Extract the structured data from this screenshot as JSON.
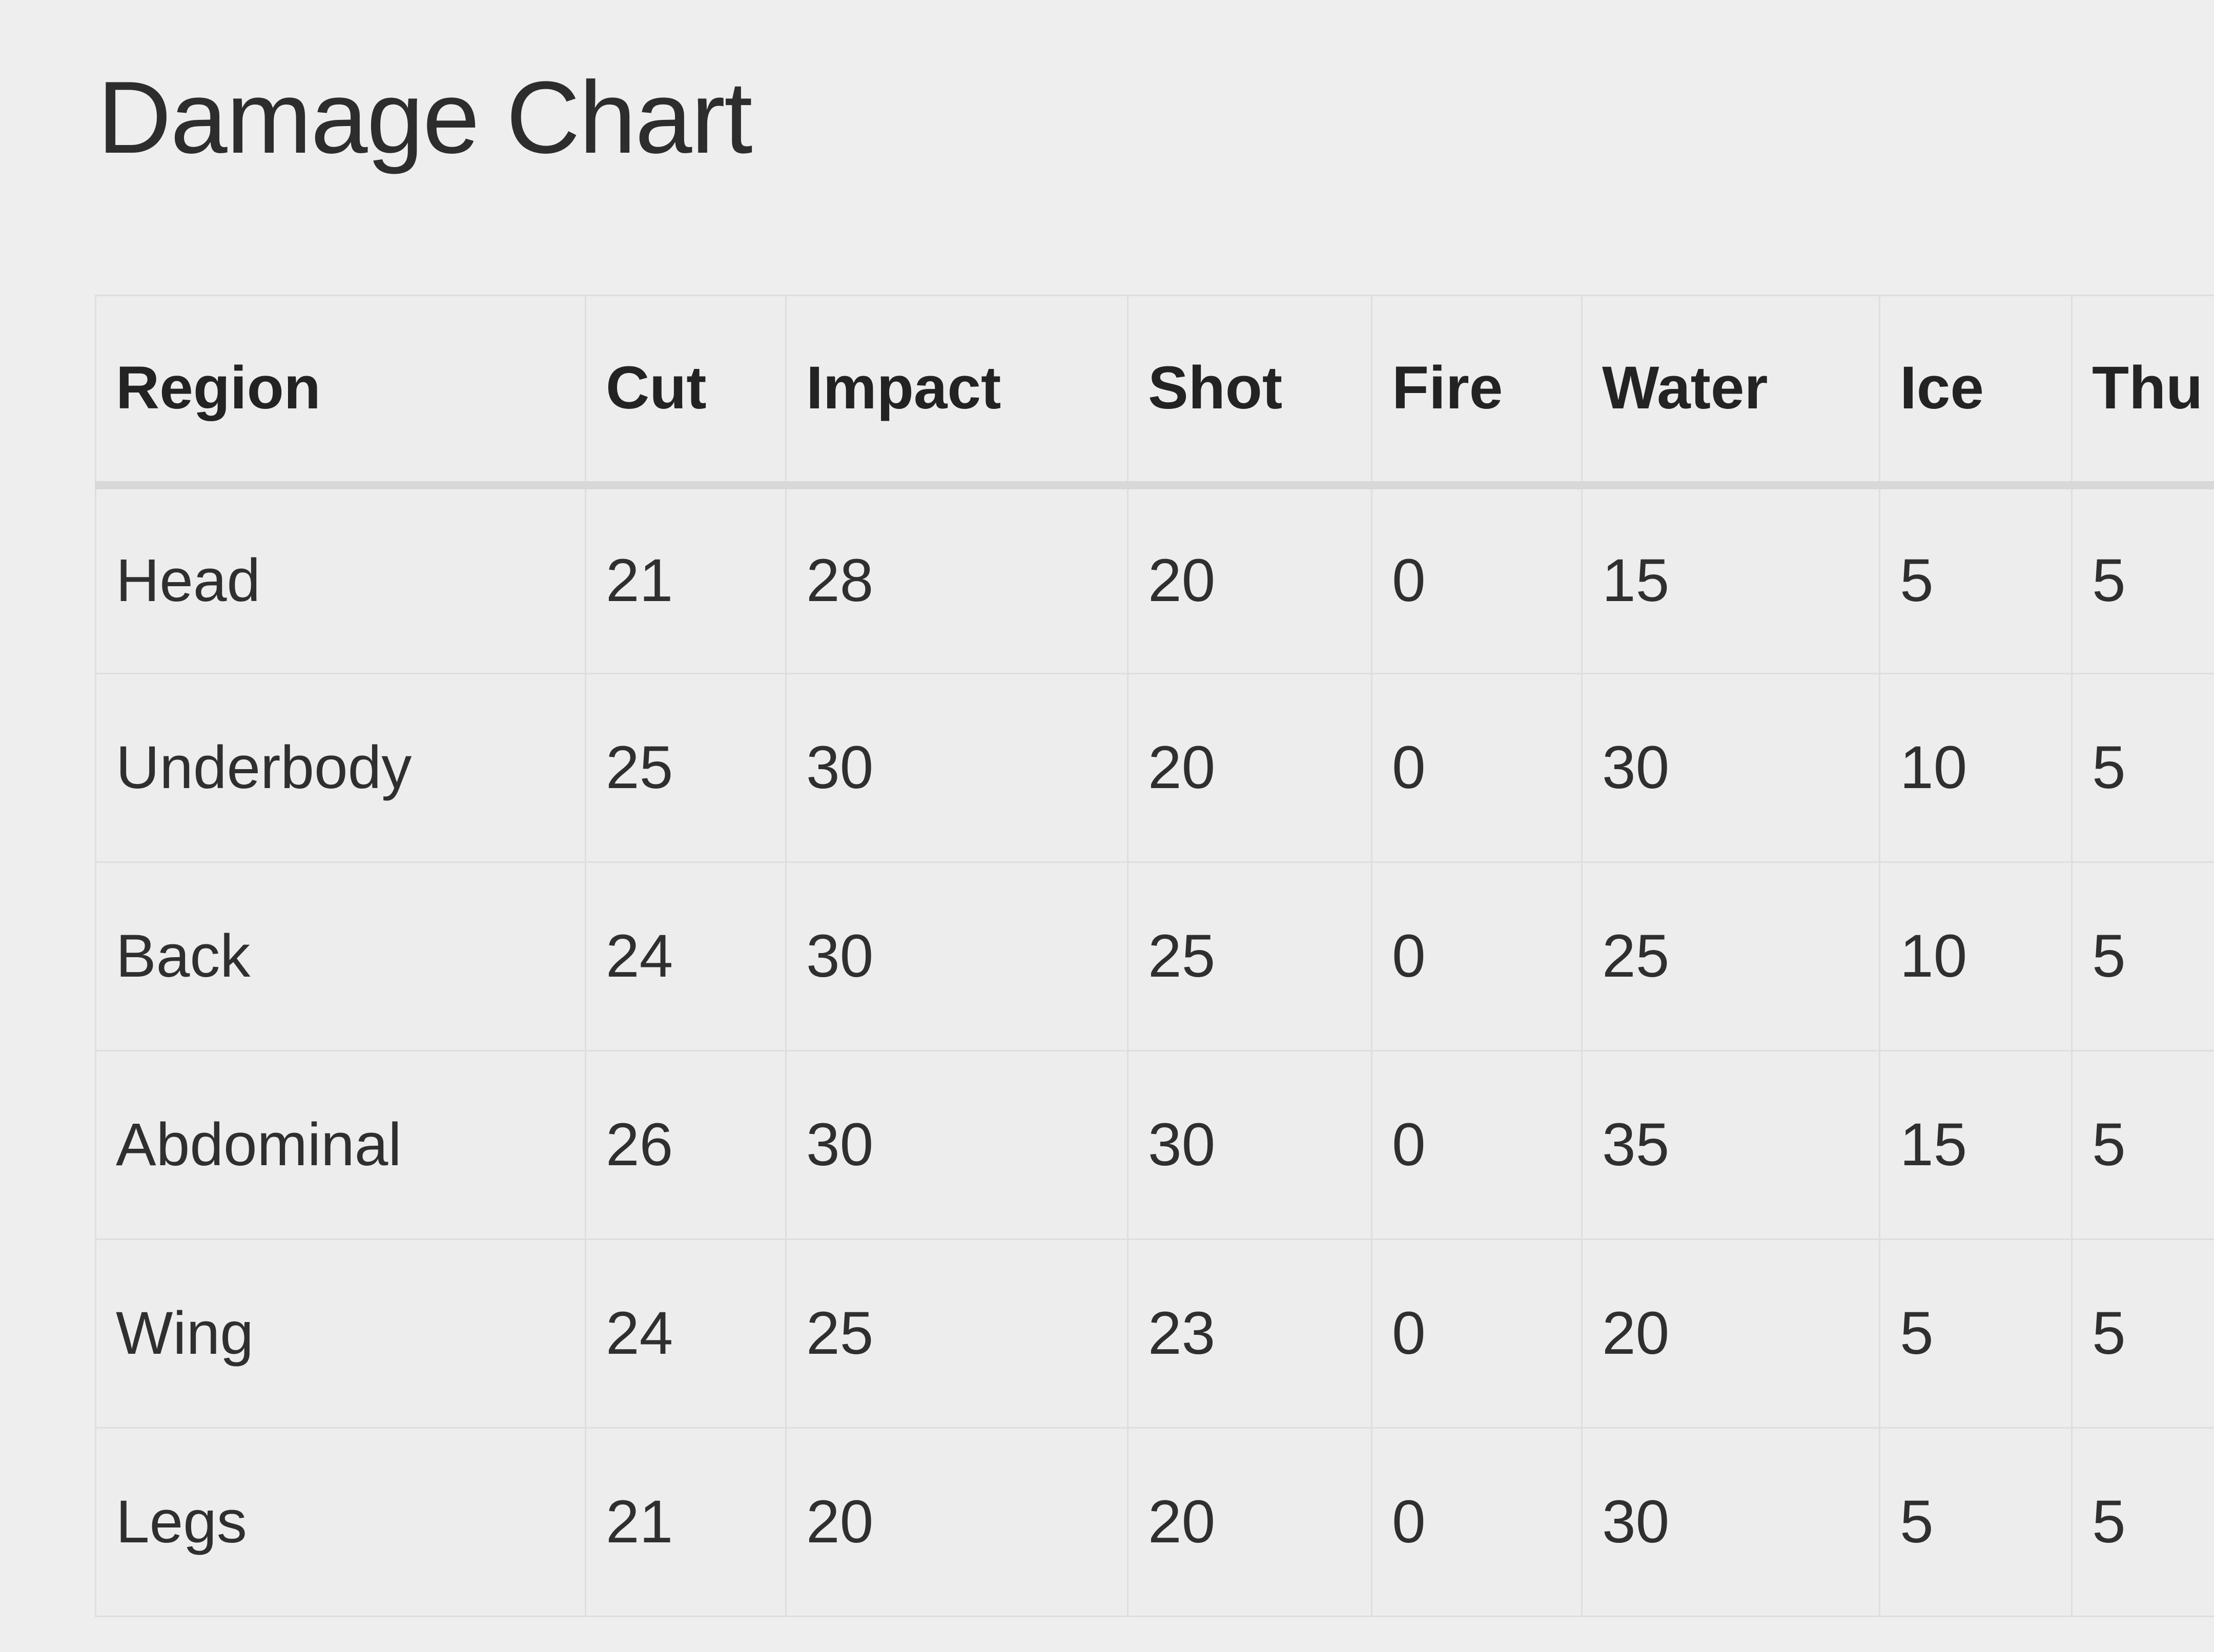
{
  "page": {
    "title": "Damage Chart",
    "background_color": "#eeeeee",
    "text_color": "#2d2d2d",
    "border_color": "#dedede",
    "header_divider_color": "#d8d8d8"
  },
  "table": {
    "name": "damage-chart-table",
    "columns": [
      {
        "key": "region",
        "label": "Region"
      },
      {
        "key": "cut",
        "label": "Cut"
      },
      {
        "key": "impact",
        "label": "Impact"
      },
      {
        "key": "shot",
        "label": "Shot"
      },
      {
        "key": "fire",
        "label": "Fire"
      },
      {
        "key": "water",
        "label": "Water"
      },
      {
        "key": "ice",
        "label": "Ice"
      },
      {
        "key": "thunder",
        "label": "Thu"
      }
    ],
    "rows": [
      {
        "region": "Head",
        "cut": "21",
        "impact": "28",
        "shot": "20",
        "fire": "0",
        "water": "15",
        "ice": "5",
        "thunder": "5"
      },
      {
        "region": "Underbody",
        "cut": "25",
        "impact": "30",
        "shot": "20",
        "fire": "0",
        "water": "30",
        "ice": "10",
        "thunder": "5"
      },
      {
        "region": "Back",
        "cut": "24",
        "impact": "30",
        "shot": "25",
        "fire": "0",
        "water": "25",
        "ice": "10",
        "thunder": "5"
      },
      {
        "region": "Abdominal",
        "cut": "26",
        "impact": "30",
        "shot": "30",
        "fire": "0",
        "water": "35",
        "ice": "15",
        "thunder": "5"
      },
      {
        "region": "Wing",
        "cut": "24",
        "impact": "25",
        "shot": "23",
        "fire": "0",
        "water": "20",
        "ice": "5",
        "thunder": "5"
      },
      {
        "region": "Legs",
        "cut": "21",
        "impact": "20",
        "shot": "20",
        "fire": "0",
        "water": "30",
        "ice": "5",
        "thunder": "5"
      }
    ]
  },
  "chart_data": {
    "type": "table",
    "title": "Damage Chart",
    "categories": [
      "Head",
      "Underbody",
      "Back",
      "Abdominal",
      "Wing",
      "Legs"
    ],
    "series": [
      {
        "name": "Cut",
        "values": [
          21,
          25,
          24,
          26,
          24,
          21
        ]
      },
      {
        "name": "Impact",
        "values": [
          28,
          30,
          30,
          30,
          25,
          20
        ]
      },
      {
        "name": "Shot",
        "values": [
          20,
          20,
          25,
          30,
          23,
          20
        ]
      },
      {
        "name": "Fire",
        "values": [
          0,
          0,
          0,
          0,
          0,
          0
        ]
      },
      {
        "name": "Water",
        "values": [
          15,
          30,
          25,
          35,
          20,
          30
        ]
      },
      {
        "name": "Ice",
        "values": [
          5,
          10,
          10,
          15,
          5,
          5
        ]
      },
      {
        "name": "Thu",
        "values": [
          5,
          5,
          5,
          5,
          5,
          5
        ]
      }
    ],
    "xlabel": "Region",
    "ylabel": "",
    "grid": true,
    "legend": "none"
  }
}
